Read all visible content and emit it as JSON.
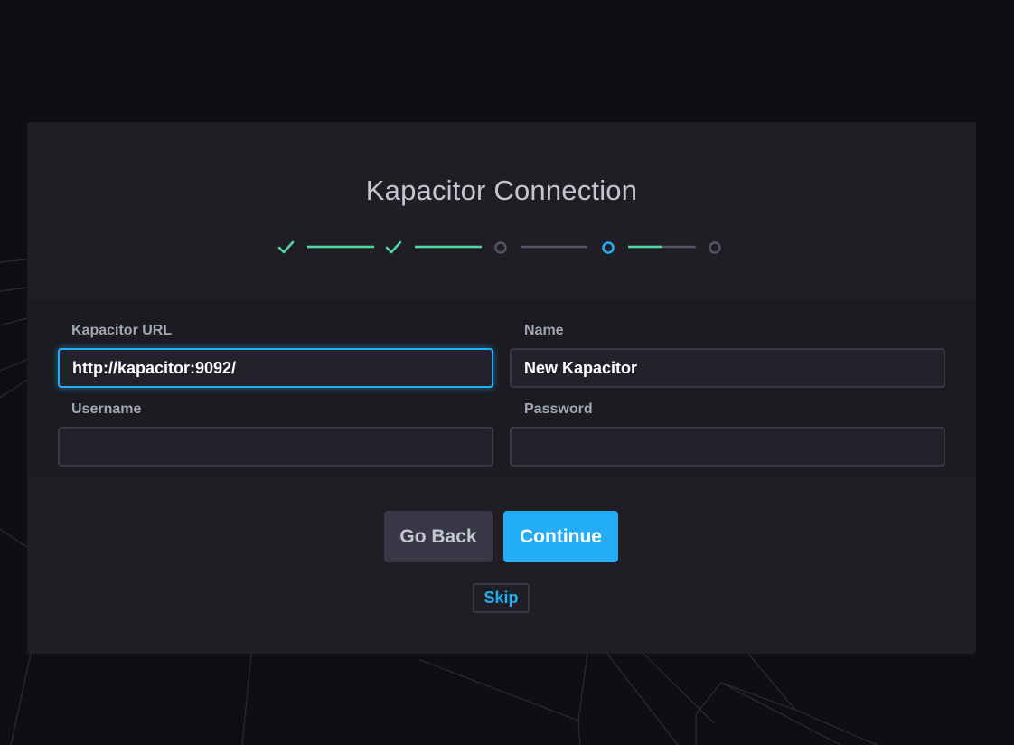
{
  "wizard": {
    "title": "Kapacitor Connection",
    "steps": [
      {
        "status": "complete"
      },
      {
        "status": "complete"
      },
      {
        "status": "pending"
      },
      {
        "status": "current"
      },
      {
        "status": "pending"
      }
    ],
    "connectors": [
      {
        "progress": 1.0
      },
      {
        "progress": 1.0
      },
      {
        "progress": 0.0
      },
      {
        "progress": 0.5
      }
    ]
  },
  "form": {
    "url": {
      "label": "Kapacitor URL",
      "value": "http://kapacitor:9092/"
    },
    "name": {
      "label": "Name",
      "value": "New Kapacitor"
    },
    "username": {
      "label": "Username",
      "value": ""
    },
    "password": {
      "label": "Password",
      "value": ""
    }
  },
  "footer": {
    "go_back_label": "Go Back",
    "continue_label": "Continue",
    "skip_label": "Skip"
  },
  "colors": {
    "page_background": "#0f0e15",
    "panel": "#1e1e24",
    "accent": "#22adf6",
    "success": "#4ed8a0",
    "muted": "#545667",
    "label": "#a3a6b3",
    "title": "#c3c6d0"
  },
  "icons": {
    "complete": "checkmark-icon",
    "current": "circle-outline-icon-active",
    "pending": "circle-outline-icon"
  }
}
